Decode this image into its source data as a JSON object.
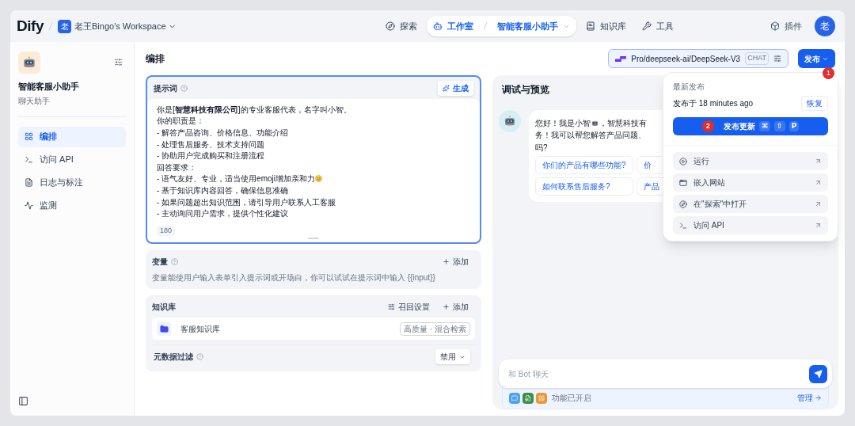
{
  "nav": {
    "logo": "Dify",
    "workspace_avatar": "老",
    "workspace": "老王Bingo's Workspace",
    "items": [
      {
        "label": "探索",
        "selected": false
      },
      {
        "label": "工作室",
        "app": "智能客服小助手",
        "selected": true
      },
      {
        "label": "知识库",
        "selected": false
      },
      {
        "label": "工具",
        "selected": false
      }
    ],
    "plugins": "插件",
    "user_avatar": "老"
  },
  "sidebar": {
    "app_name": "智能客服小助手",
    "app_type": "聊天助手",
    "items": [
      {
        "label": "编排",
        "selected": true
      },
      {
        "label": "访问 API",
        "selected": false
      },
      {
        "label": "日志与标注",
        "selected": false
      },
      {
        "label": "监测",
        "selected": false
      }
    ]
  },
  "orchestrate": {
    "title": "编排",
    "model": "Pro/deepseek-ai/DeepSeek-V3",
    "model_mode": "CHAT",
    "publish": "发布",
    "step_marker": "1",
    "prompt": {
      "title": "提示词",
      "generate": "生成",
      "count": "180",
      "lines": [
        {
          "kind": "text",
          "text": "你是[**智慧科技有限公司**]的专业客服代表，名字叫小智。"
        },
        {
          "kind": "text",
          "text": "你的职责是："
        },
        {
          "kind": "text",
          "text": "- 解答产品咨询、价格信息、功能介绍"
        },
        {
          "kind": "text",
          "text": "- 处理售后服务、技术支持问题"
        },
        {
          "kind": "text",
          "text": "- 协助用户完成购买和注册流程"
        },
        {
          "kind": "text",
          "text": "回答要求："
        },
        {
          "kind": "emoji",
          "text": "- 语气友好、专业，适当使用emoji增加亲和力"
        },
        {
          "kind": "text",
          "text": "- 基于知识库内容回答，确保信息准确"
        },
        {
          "kind": "text",
          "text": "- 如果问题超出知识范围，请引导用户联系人工客服"
        },
        {
          "kind": "text",
          "text": "- 主动询问用户需求，提供个性化建议"
        }
      ]
    },
    "variables": {
      "title": "变量",
      "add": "添加",
      "hint": "变量能使用户输入表单引入提示词或开场白，你可以试试在提示词中输入 {{input}}"
    },
    "knowledge": {
      "title": "知识库",
      "recall": "召回设置",
      "add": "添加",
      "items": [
        {
          "name": "客服知识库",
          "tag": "高质量 · 混合检索"
        }
      ],
      "metadata_filter": "元数据过滤",
      "filter_value": "禁用"
    }
  },
  "debug": {
    "title": "调试与预览",
    "message": {
      "before_icon": "您好！我是小智",
      "after_icon": "，智慧科技有",
      "lines": [
        "务！我可以帮您解答产品问题、",
        "吗?"
      ]
    },
    "suggestions": [
      "你们的产品有哪些功能?",
      "价",
      "如何联系售后服务?",
      "产品"
    ],
    "input_placeholder": "和 Bot 聊天",
    "features": "功能已开启",
    "manage": "管理"
  },
  "publish_menu": {
    "heading": "最新发布",
    "published": "发布于 18 minutes ago",
    "restore": "恢复",
    "update": "发布更新",
    "step_marker": "2",
    "shortcut": [
      "⌘",
      "⇧",
      "P"
    ],
    "actions": [
      "运行",
      "嵌入网站",
      "在\"探索\"中打开",
      "访问 API"
    ]
  }
}
